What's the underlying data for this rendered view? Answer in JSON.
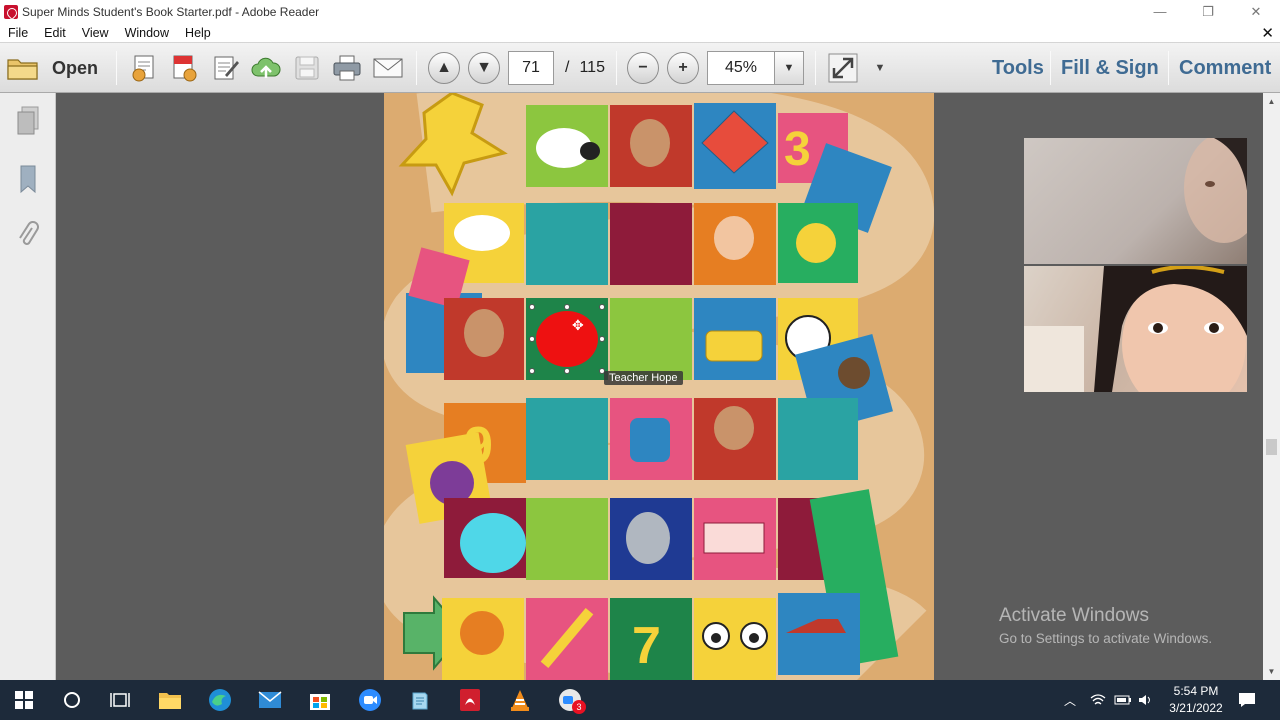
{
  "window": {
    "title": "Super Minds Student's Book Starter.pdf - Adobe Reader",
    "minimize": "—",
    "restore": "❐",
    "close": "✕"
  },
  "menubar": {
    "items": [
      "File",
      "Edit",
      "View",
      "Window",
      "Help"
    ],
    "close_doc": "✕"
  },
  "toolbar": {
    "open_label": "Open",
    "page_current": "71",
    "page_separator": "/",
    "page_total": "115",
    "zoom_value": "45%",
    "tools_label": "Tools",
    "fill_sign_label": "Fill & Sign",
    "comment_label": "Comment"
  },
  "document": {
    "annotation_label": "Teacher Hope"
  },
  "watermark": {
    "line1": "Activate Windows",
    "line2": "Go to Settings to activate Windows."
  },
  "taskbar": {
    "time": "5:54 PM",
    "date": "3/21/2022",
    "zoom_badge": "3"
  },
  "colors": {
    "accent_tools": "#3f6b93",
    "taskbar": "#1d2a3a",
    "red_shape": "#ee1111",
    "cyan_shape": "#4fd7e8"
  }
}
